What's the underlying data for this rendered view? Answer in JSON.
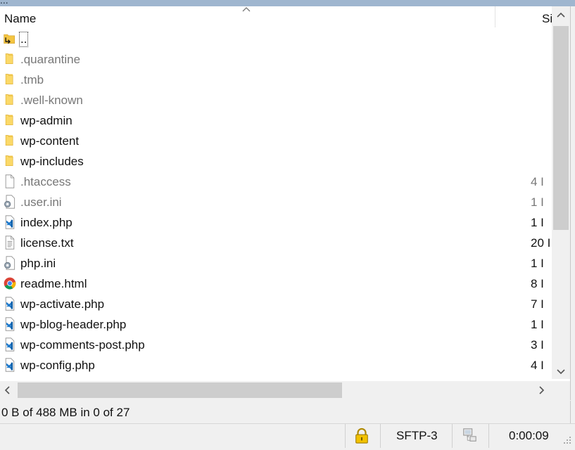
{
  "window": {
    "title_fragment": "...",
    "accent": "#9fb6cf"
  },
  "list_header": {
    "name_label": "Name",
    "size_label": "Si"
  },
  "files": [
    {
      "name": "..",
      "size": "",
      "type": "parent",
      "hidden": false
    },
    {
      "name": ".quarantine",
      "size": "",
      "type": "folder",
      "hidden": true
    },
    {
      "name": ".tmb",
      "size": "",
      "type": "folder",
      "hidden": true
    },
    {
      "name": ".well-known",
      "size": "",
      "type": "folder",
      "hidden": true
    },
    {
      "name": "wp-admin",
      "size": "",
      "type": "folder",
      "hidden": false
    },
    {
      "name": "wp-content",
      "size": "",
      "type": "folder",
      "hidden": false
    },
    {
      "name": "wp-includes",
      "size": "",
      "type": "folder",
      "hidden": false
    },
    {
      "name": ".htaccess",
      "size": "4 I",
      "type": "file",
      "hidden": true
    },
    {
      "name": ".user.ini",
      "size": "1 I",
      "type": "config",
      "hidden": true
    },
    {
      "name": "index.php",
      "size": "1 I",
      "type": "php",
      "hidden": false
    },
    {
      "name": "license.txt",
      "size": "20 I",
      "type": "text",
      "hidden": false
    },
    {
      "name": "php.ini",
      "size": "1 I",
      "type": "config",
      "hidden": false
    },
    {
      "name": "readme.html",
      "size": "8 I",
      "type": "html",
      "hidden": false
    },
    {
      "name": "wp-activate.php",
      "size": "7 I",
      "type": "php",
      "hidden": false
    },
    {
      "name": "wp-blog-header.php",
      "size": "1 I",
      "type": "php",
      "hidden": false
    },
    {
      "name": "wp-comments-post.php",
      "size": "3 I",
      "type": "php",
      "hidden": false
    },
    {
      "name": "wp-config.php",
      "size": "4 I",
      "type": "php",
      "hidden": false
    }
  ],
  "status": {
    "selection_text": "0 B of 488 MB in 0 of 27"
  },
  "statusbar": {
    "protocol": "SFTP-3",
    "elapsed": "0:00:09",
    "lock_icon": "padlock-icon",
    "network_icon": "network-icon"
  }
}
